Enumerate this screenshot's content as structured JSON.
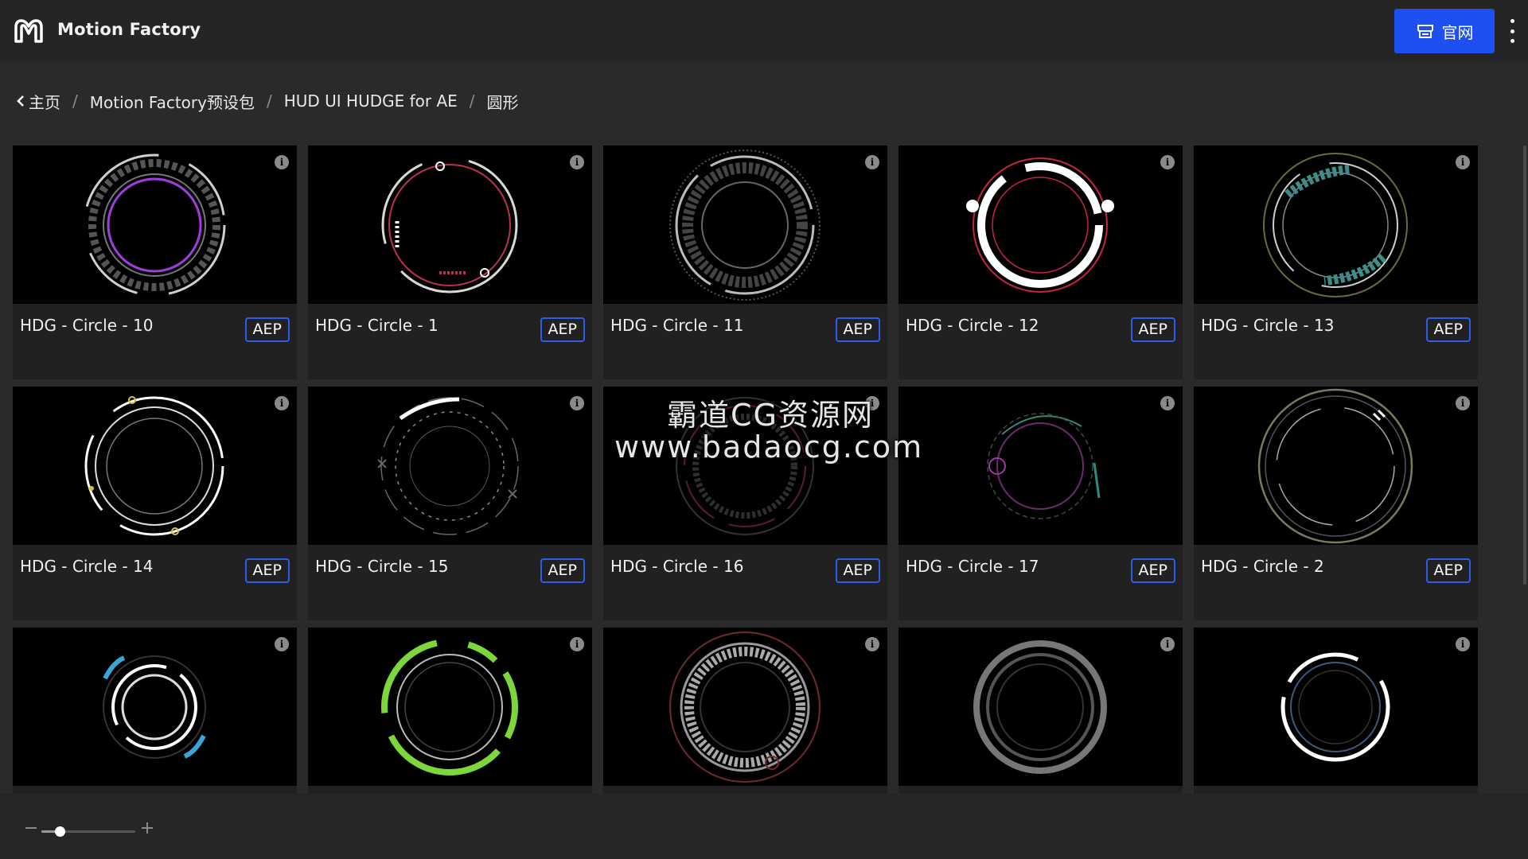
{
  "header": {
    "title": "Motion Factory",
    "logo_icon": "motion-factory-logo-icon",
    "official_button_label": "官网",
    "official_button_icon": "store-icon",
    "more_icon": "vertical-ellipsis-icon",
    "accent_color": "#1e4ff0"
  },
  "breadcrumb": {
    "items": [
      "主页",
      "Motion Factory预设包",
      "HUD UI HUDGE for AE",
      "圆形"
    ],
    "separator": "/"
  },
  "cards": [
    {
      "title": "HDG - Circle - 10",
      "badge": "AEP"
    },
    {
      "title": "HDG - Circle - 1",
      "badge": "AEP"
    },
    {
      "title": "HDG - Circle - 11",
      "badge": "AEP"
    },
    {
      "title": "HDG - Circle - 12",
      "badge": "AEP"
    },
    {
      "title": "HDG - Circle - 13",
      "badge": "AEP"
    },
    {
      "title": "HDG - Circle - 14",
      "badge": "AEP"
    },
    {
      "title": "HDG - Circle - 15",
      "badge": "AEP"
    },
    {
      "title": "HDG - Circle - 16",
      "badge": "AEP"
    },
    {
      "title": "HDG - Circle - 17",
      "badge": "AEP"
    },
    {
      "title": "HDG - Circle - 2",
      "badge": "AEP"
    },
    {
      "title": "",
      "badge": ""
    },
    {
      "title": "",
      "badge": ""
    },
    {
      "title": "",
      "badge": ""
    },
    {
      "title": "",
      "badge": ""
    },
    {
      "title": "",
      "badge": ""
    }
  ],
  "watermark": {
    "line1": "霸道CG资源网",
    "line2": "www.badaocg.com"
  },
  "zoom": {
    "level": 0.2
  }
}
